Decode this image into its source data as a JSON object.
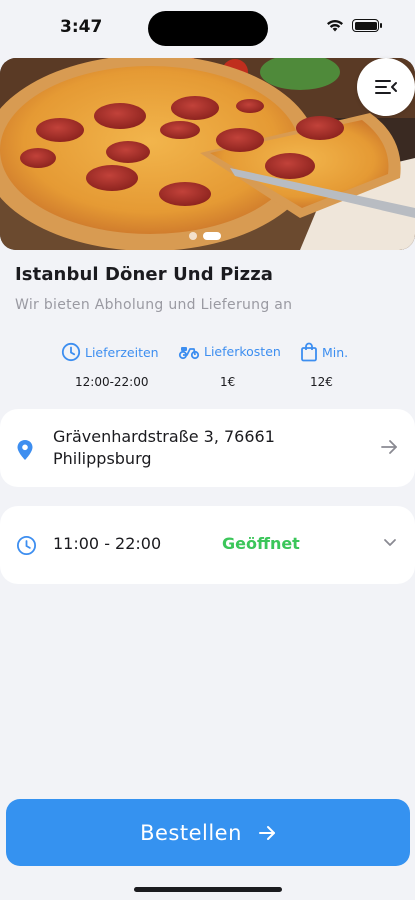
{
  "status_bar": {
    "time": "3:47"
  },
  "hero": {
    "image": "pizza-photo",
    "slides": 2,
    "active_slide": 2
  },
  "restaurant": {
    "name": "Istanbul Döner Und Pizza",
    "tagline": "Wir bieten Abholung und Lieferung an"
  },
  "stats": [
    {
      "icon": "clock-icon",
      "label": "Lieferzeiten",
      "value": "12:00-22:00"
    },
    {
      "icon": "scooter-icon",
      "label": "Lieferkosten",
      "value": "1€"
    },
    {
      "icon": "bag-icon",
      "label": "Min.",
      "value": "12€"
    }
  ],
  "address": {
    "line1": "Grävenhardstraße 3, 76661",
    "line2": "Philippsburg"
  },
  "hours": {
    "time": "11:00 - 22:00",
    "status": "Geöffnet"
  },
  "order_button": {
    "label": "Bestellen"
  },
  "colors": {
    "accent": "#3592f0",
    "open_status": "#3bc65a",
    "background": "#f2f3f7"
  }
}
